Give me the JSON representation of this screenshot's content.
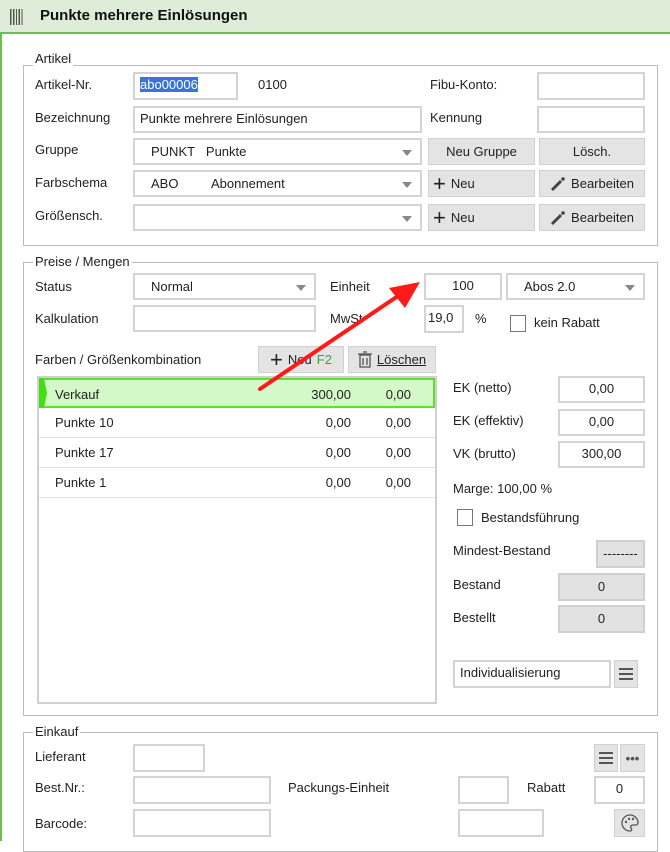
{
  "title": "Punkte mehrere Einlösungen",
  "artikel": {
    "legend": "Artikel",
    "artikel_nr_label": "Artikel-Nr.",
    "artikel_nr": "abo00006",
    "code": "0100",
    "fibu_label": "Fibu-Konto:",
    "fibu": "",
    "bezeichnung_label": "Bezeichnung",
    "bezeichnung": "Punkte mehrere Einlösungen",
    "kennung_label": "Kennung",
    "kennung": "",
    "gruppe_label": "Gruppe",
    "gruppe_code": "PUNKT",
    "gruppe_name": "Punkte",
    "neu_gruppe": "Neu Gruppe",
    "loesch": "Lösch.",
    "farbschema_label": "Farbschema",
    "farbschema_code": "ABO",
    "farbschema_name": "Abonnement",
    "neu": "Neu",
    "bearbeiten": "Bearbeiten",
    "groessen_label": "Größensch.",
    "groessen": ""
  },
  "preise": {
    "legend": "Preise / Mengen",
    "status_label": "Status",
    "status": "Normal",
    "einheit_label": "Einheit",
    "einheit": "100",
    "einheit_typ": "Abos 2.0",
    "kalkulation_label": "Kalkulation",
    "kalkulation": "",
    "mwst_label": "MwSt",
    "mwst": "19,0",
    "percent": "%",
    "kein_rabatt": "kein Rabatt",
    "kombi_label": "Farben / Größenkombination",
    "neu": "Neu",
    "neu_key": "F2",
    "loeschen": "Löschen",
    "rows": [
      {
        "name": "Verkauf",
        "v1": "300,00",
        "v2": "0,00"
      },
      {
        "name": "Punkte 10",
        "v1": "0,00",
        "v2": "0,00"
      },
      {
        "name": "Punkte 17",
        "v1": "0,00",
        "v2": "0,00"
      },
      {
        "name": "Punkte 1",
        "v1": "0,00",
        "v2": "0,00"
      }
    ],
    "ek_netto_label": "EK (netto)",
    "ek_netto": "0,00",
    "ek_eff_label": "EK (effektiv)",
    "ek_eff": "0,00",
    "vk_label": "VK (brutto)",
    "vk": "300,00",
    "marge": "Marge: 100,00 %",
    "bestandsfuehrung": "Bestandsführung",
    "mindest_label": "Mindest-Bestand",
    "mindest": "--------",
    "bestand_label": "Bestand",
    "bestand": "0",
    "bestellt_label": "Bestellt",
    "bestellt": "0",
    "individualisierung": "Individualisierung"
  },
  "einkauf": {
    "legend": "Einkauf",
    "lieferant_label": "Lieferant",
    "lieferant": "",
    "bestnr_label": "Best.Nr.:",
    "bestnr": "",
    "packung_label": "Packungs-Einheit",
    "packung": "",
    "rabatt_label": "Rabatt",
    "rabatt": "0",
    "barcode_label": "Barcode:",
    "barcode": "",
    "extra": ""
  },
  "colors": {
    "accent": "#6cbf4a",
    "selected_row": "#d5f8c8",
    "arrow": "#ff1a1a"
  }
}
